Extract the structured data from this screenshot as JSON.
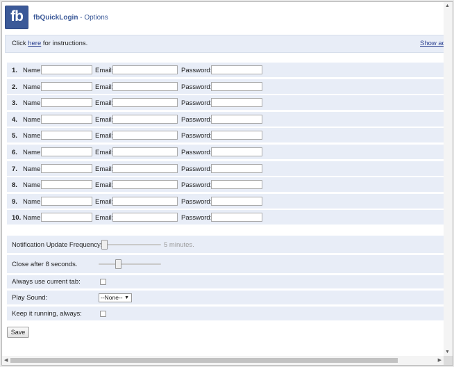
{
  "header": {
    "logo_text": "fb",
    "app_name": "fbQuickLogin",
    "separator": " - ",
    "subtitle": "Options"
  },
  "instructions": {
    "prefix": "Click ",
    "link_text": "here",
    "suffix": " for instructions.",
    "show_advanced": "Show adv"
  },
  "accounts": {
    "name_label": "Name:",
    "email_label": "Email:",
    "password_label": "Password:",
    "rows": [
      {
        "num": "1.",
        "name": "",
        "email": "",
        "password": ""
      },
      {
        "num": "2.",
        "name": "",
        "email": "",
        "password": ""
      },
      {
        "num": "3.",
        "name": "",
        "email": "",
        "password": ""
      },
      {
        "num": "4.",
        "name": "",
        "email": "",
        "password": ""
      },
      {
        "num": "5.",
        "name": "",
        "email": "",
        "password": ""
      },
      {
        "num": "6.",
        "name": "",
        "email": "",
        "password": ""
      },
      {
        "num": "7.",
        "name": "",
        "email": "",
        "password": ""
      },
      {
        "num": "8.",
        "name": "",
        "email": "",
        "password": ""
      },
      {
        "num": "9.",
        "name": "",
        "email": "",
        "password": ""
      },
      {
        "num": "10.",
        "name": "",
        "email": "",
        "password": ""
      }
    ]
  },
  "options": {
    "notification_label": "Notification Update Frequency:",
    "notification_value_text": "5 minutes.",
    "notification_slider_fraction": 0.05,
    "close_after_label": "Close after 8 seconds.",
    "close_after_slider_fraction": 0.3,
    "current_tab_label": "Always use current tab:",
    "current_tab_checked": false,
    "play_sound_label": "Play Sound:",
    "play_sound_value": "--None--",
    "keep_running_label": "Keep it running, always:",
    "keep_running_checked": false
  },
  "save_label": "Save",
  "icons": {
    "select_caret": "▼",
    "scroll_up": "▲",
    "scroll_down": "▼",
    "scroll_left": "◀",
    "scroll_right": "▶"
  },
  "colors": {
    "brand": "#3b5998",
    "row_background": "#e8edf7"
  }
}
